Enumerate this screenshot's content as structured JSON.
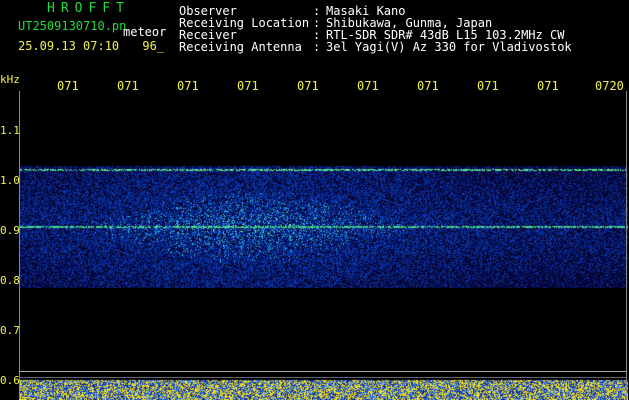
{
  "header": {
    "title": "HROFFT",
    "file_name": "UT2509130710.pn",
    "mode": "meteor",
    "timestamp": "25.09.13 07:10",
    "frame_code": "96_"
  },
  "info": [
    {
      "key": "Observer",
      "value": "Masaki Kano"
    },
    {
      "key": "Receiving Location",
      "value": "Shibukawa, Gunma, Japan"
    },
    {
      "key": "Receiver",
      "value": "RTL-SDR SDR# 43dB L15 103.2MHz CW"
    },
    {
      "key": "Receiving Antenna",
      "value": "3el Yagi(V) Az 330 for Vladivostok"
    }
  ],
  "axis": {
    "y_unit": "kHz",
    "y_ticks": [
      "1.1",
      "1.0",
      "0.9",
      "0.8",
      "0.7",
      "0.6"
    ],
    "x_ticks": [
      "071",
      "071",
      "071",
      "071",
      "071",
      "071",
      "071",
      "071",
      "071",
      "0720"
    ]
  },
  "colors": {
    "background": "#000000",
    "noise_band": "#1e2db4",
    "signal_line": "#39e08a",
    "label_yellow": "#f2f24a",
    "label_green": "#1fdc3a",
    "echo_strip": "#f0e020"
  }
}
